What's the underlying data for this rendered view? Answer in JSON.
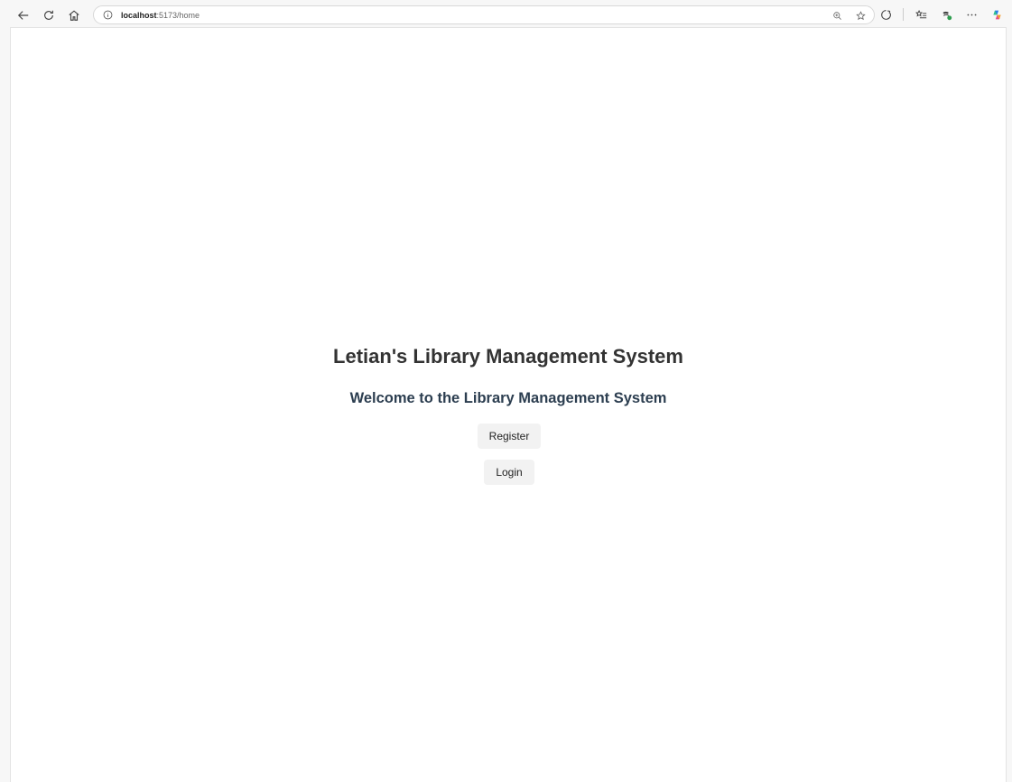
{
  "browser": {
    "url_host": "localhost",
    "url_path": ":5173/home",
    "nav_icons": [
      "back-arrow-icon",
      "refresh-icon",
      "home-icon"
    ],
    "address_icons": [
      "info-icon",
      "zoom-icon",
      "favorite-star-icon"
    ],
    "toolbar_icons": [
      "extensions-icon",
      "favorites-list-icon",
      "browser-essentials-icon",
      "more-menu-icon",
      "copilot-icon"
    ]
  },
  "page": {
    "title": "Letian's Library Management System",
    "welcome": "Welcome to the Library Management System",
    "register_label": "Register",
    "login_label": "Login"
  },
  "colors": {
    "title": "#333333",
    "welcome": "#2c3e50",
    "button_bg": "#f2f2f2"
  }
}
